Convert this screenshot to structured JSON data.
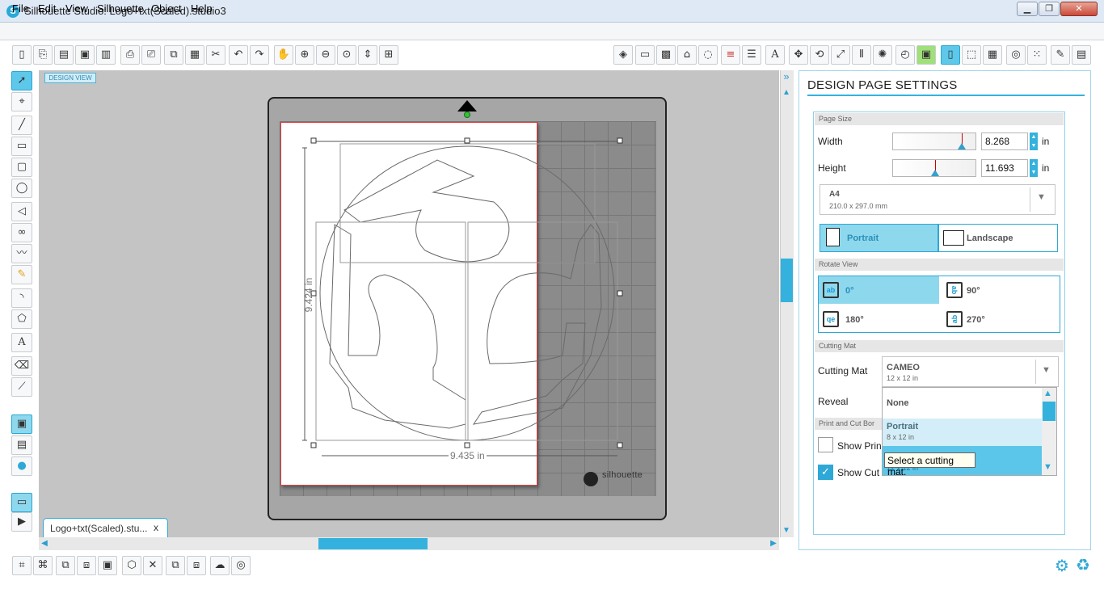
{
  "window": {
    "title": "Silhouette Studio: Logo+txt(Scaled).studio3",
    "logo_glyph": "S",
    "minimize": "▁",
    "maximize": "❐",
    "close": "✕",
    "close_color": "#c94a3a"
  },
  "menu": [
    "File",
    "Edit",
    "View",
    "Silhouette",
    "Object",
    "Help"
  ],
  "toolbar_icons": {
    "left": [
      "new-document-icon",
      "open-icon",
      "template-icon",
      "save-icon",
      "save-to-library-icon",
      "print-icon",
      "print-and-cut-icon",
      "copy-icon",
      "paste-icon",
      "cut-icon",
      "undo-icon",
      "redo-icon",
      "pan-icon",
      "zoom-in-icon",
      "zoom-out-icon",
      "zoom-select-icon",
      "zoom-fit-icon",
      "fit-to-page-icon"
    ],
    "right": [
      "fill-color-icon",
      "fill-gradient-icon",
      "fill-pattern-icon",
      "line-color-icon",
      "line-style-icon",
      "line-width-icon",
      "line-dash-icon",
      "text-style-icon",
      "transform-icon",
      "rotate-icon",
      "scale-icon",
      "align-icon",
      "replicate-icon",
      "modify-icon",
      "offset-icon",
      "design-page-settings-icon",
      "trace-icon",
      "grid-icon",
      "cut-settings-icon",
      "send-to-silhouette-icon",
      "library-icon",
      "store-icon"
    ]
  },
  "canvas": {
    "view_label": "DESIGN VIEW",
    "width_dim": "9.435 in",
    "height_dim": "9.424 in",
    "brand": "silhouette"
  },
  "doc_tab": {
    "label": "Logo+txt(Scaled).stu...",
    "close": "x"
  },
  "panel": {
    "title": "DESIGN PAGE SETTINGS",
    "page_size_header": "Page Size",
    "width_label": "Width",
    "width_value": "8.268",
    "width_unit": "in",
    "height_label": "Height",
    "height_value": "11.693",
    "height_unit": "in",
    "paper_name": "A4",
    "paper_dims": "210.0 x 297.0 mm",
    "portrait": "Portrait",
    "landscape": "Landscape",
    "rotate_header": "Rotate View",
    "rot_0": "0°",
    "rot_90": "90°",
    "rot_180": "180°",
    "rot_270": "270°",
    "rot_icon_text": "ab",
    "rot_icon_text_inv": "qe",
    "cutting_mat_header": "Cutting Mat",
    "cutting_mat_label": "Cutting Mat",
    "mat_selected": "CAMEO",
    "mat_selected_size": "12 x 12 in",
    "reveal_label": "Reveal",
    "print_cut_header": "Print and Cut Bor",
    "show_print_label": "Show Print",
    "show_cut_label": "Show Cut",
    "dropdown_options": [
      {
        "name": "None",
        "size": ""
      },
      {
        "name": "Portrait",
        "size": "8 x 12 in"
      },
      {
        "name": "",
        "size": "12 x 12 in"
      }
    ],
    "tooltip": "Select a cutting mat.",
    "accent_color": "#34b2dd"
  }
}
